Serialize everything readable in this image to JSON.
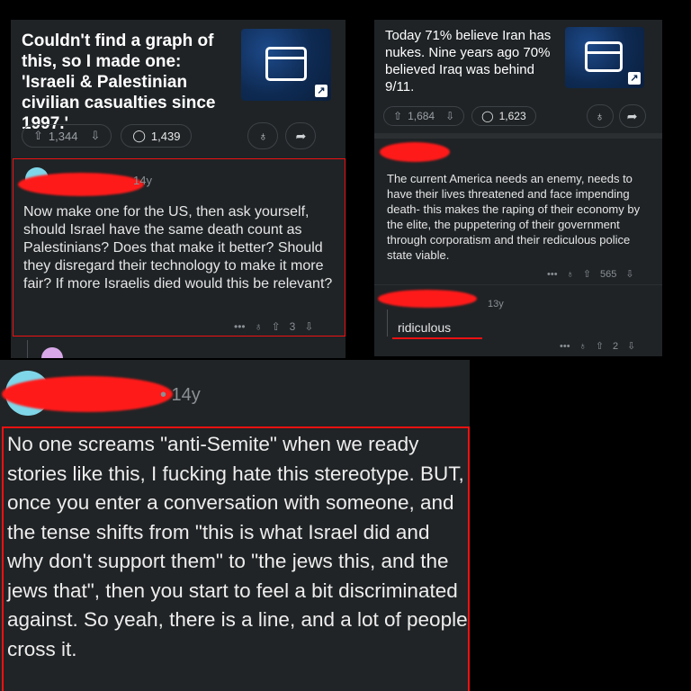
{
  "post1": {
    "title": "Couldn't find a graph of this, so I made one: 'Israeli & Palestinian civilian casualties since 1997.'",
    "upvotes": "1,344",
    "comments": "1,439",
    "comment": {
      "meta": "14y",
      "text": "Now make one for the US, then ask yourself, should Israel have the same death count as Palestinians? Does that make it better? Should they disregard their technology to make it more fair? If more Israelis died would this be relevant?",
      "score": "3",
      "more": "•••"
    }
  },
  "post2": {
    "title": "Today 71% believe Iran has nukes. Nine years ago 70% believed Iraq was behind 9/11.",
    "upvotes": "1,684",
    "comments": "1,623",
    "comment": {
      "text": "The current America needs an enemy, needs to have their lives threatened and face impending death- this makes the raping of their economy by the elite, the puppetering of their government through corporatism and their rediculous police state viable.",
      "score": "565",
      "more": "•••"
    },
    "reply": {
      "meta": "13y",
      "text": "ridiculous",
      "score": "2",
      "more": "•••"
    }
  },
  "comment3": {
    "meta": "• 14y",
    "text": "No one screams \"anti-Semite\" when we ready stories like this, I fucking hate this stereotype. BUT, once you enter a conversation with someone, and the tense shifts from \"this is what Israel did and why don't support them\" to \"the jews this, and the jews that\", then you start to feel a bit discriminated against. So yeah, there is a line, and a lot of people cross it."
  },
  "icons": {
    "upvote": "arrow-up-icon",
    "downvote": "arrow-down-icon",
    "comment": "comment-bubble-icon",
    "award": "award-icon",
    "share": "share-icon",
    "external": "external-link-icon"
  },
  "colors": {
    "panel_bg": "#1f2326",
    "redaction": "#ff1a1a",
    "highlight_box": "#ee1111",
    "thumb_bg": "#0e2a52"
  }
}
